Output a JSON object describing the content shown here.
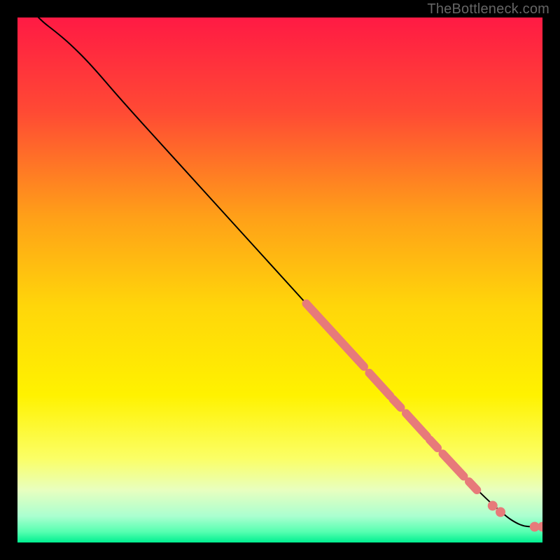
{
  "watermark": "TheBottleneck.com",
  "chart_data": {
    "type": "line",
    "title": "",
    "xlabel": "",
    "ylabel": "",
    "xlim": [
      0,
      100
    ],
    "ylim": [
      0,
      100
    ],
    "background_gradient": {
      "stops": [
        {
          "t": 0.0,
          "color": "#ff1a44"
        },
        {
          "t": 0.18,
          "color": "#ff4a34"
        },
        {
          "t": 0.38,
          "color": "#ffa018"
        },
        {
          "t": 0.55,
          "color": "#ffd60a"
        },
        {
          "t": 0.72,
          "color": "#fff200"
        },
        {
          "t": 0.84,
          "color": "#fbff66"
        },
        {
          "t": 0.9,
          "color": "#e8ffbf"
        },
        {
          "t": 0.95,
          "color": "#aaffd0"
        },
        {
          "t": 0.98,
          "color": "#55ffb0"
        },
        {
          "t": 1.0,
          "color": "#00f090"
        }
      ]
    },
    "curve": {
      "color": "#000000",
      "points": [
        {
          "x": 4,
          "y": 100
        },
        {
          "x": 5,
          "y": 99
        },
        {
          "x": 7,
          "y": 97.5
        },
        {
          "x": 10,
          "y": 95
        },
        {
          "x": 14,
          "y": 91
        },
        {
          "x": 20,
          "y": 84
        },
        {
          "x": 30,
          "y": 73
        },
        {
          "x": 40,
          "y": 62
        },
        {
          "x": 50,
          "y": 51
        },
        {
          "x": 60,
          "y": 40
        },
        {
          "x": 70,
          "y": 29
        },
        {
          "x": 80,
          "y": 18
        },
        {
          "x": 88,
          "y": 9.5
        },
        {
          "x": 93,
          "y": 5
        },
        {
          "x": 95,
          "y": 3.7
        },
        {
          "x": 96.5,
          "y": 3.1
        },
        {
          "x": 98,
          "y": 3.0
        },
        {
          "x": 100,
          "y": 3.0
        }
      ]
    },
    "series": [
      {
        "name": "segments",
        "type": "segments",
        "color": "#e77a7a",
        "stroke_width": 12,
        "items": [
          {
            "x1": 55,
            "y1": 45.5,
            "x2": 66,
            "y2": 33.5
          },
          {
            "x1": 67,
            "y1": 32.3,
            "x2": 71,
            "y2": 27.9
          },
          {
            "x1": 71.5,
            "y1": 27.3,
            "x2": 73,
            "y2": 25.7
          },
          {
            "x1": 74,
            "y1": 24.6,
            "x2": 78,
            "y2": 20.2
          },
          {
            "x1": 78.5,
            "y1": 19.6,
            "x2": 80,
            "y2": 18.0
          },
          {
            "x1": 81,
            "y1": 16.9,
            "x2": 85,
            "y2": 12.6
          },
          {
            "x1": 86,
            "y1": 11.6,
            "x2": 87.5,
            "y2": 10.0
          }
        ]
      },
      {
        "name": "dots",
        "type": "dots",
        "color": "#e77a7a",
        "radius": 7,
        "items": [
          {
            "x": 90.5,
            "y": 7.0
          },
          {
            "x": 92.0,
            "y": 5.8
          },
          {
            "x": 98.5,
            "y": 3.0
          },
          {
            "x": 100.0,
            "y": 3.0
          }
        ]
      }
    ]
  }
}
